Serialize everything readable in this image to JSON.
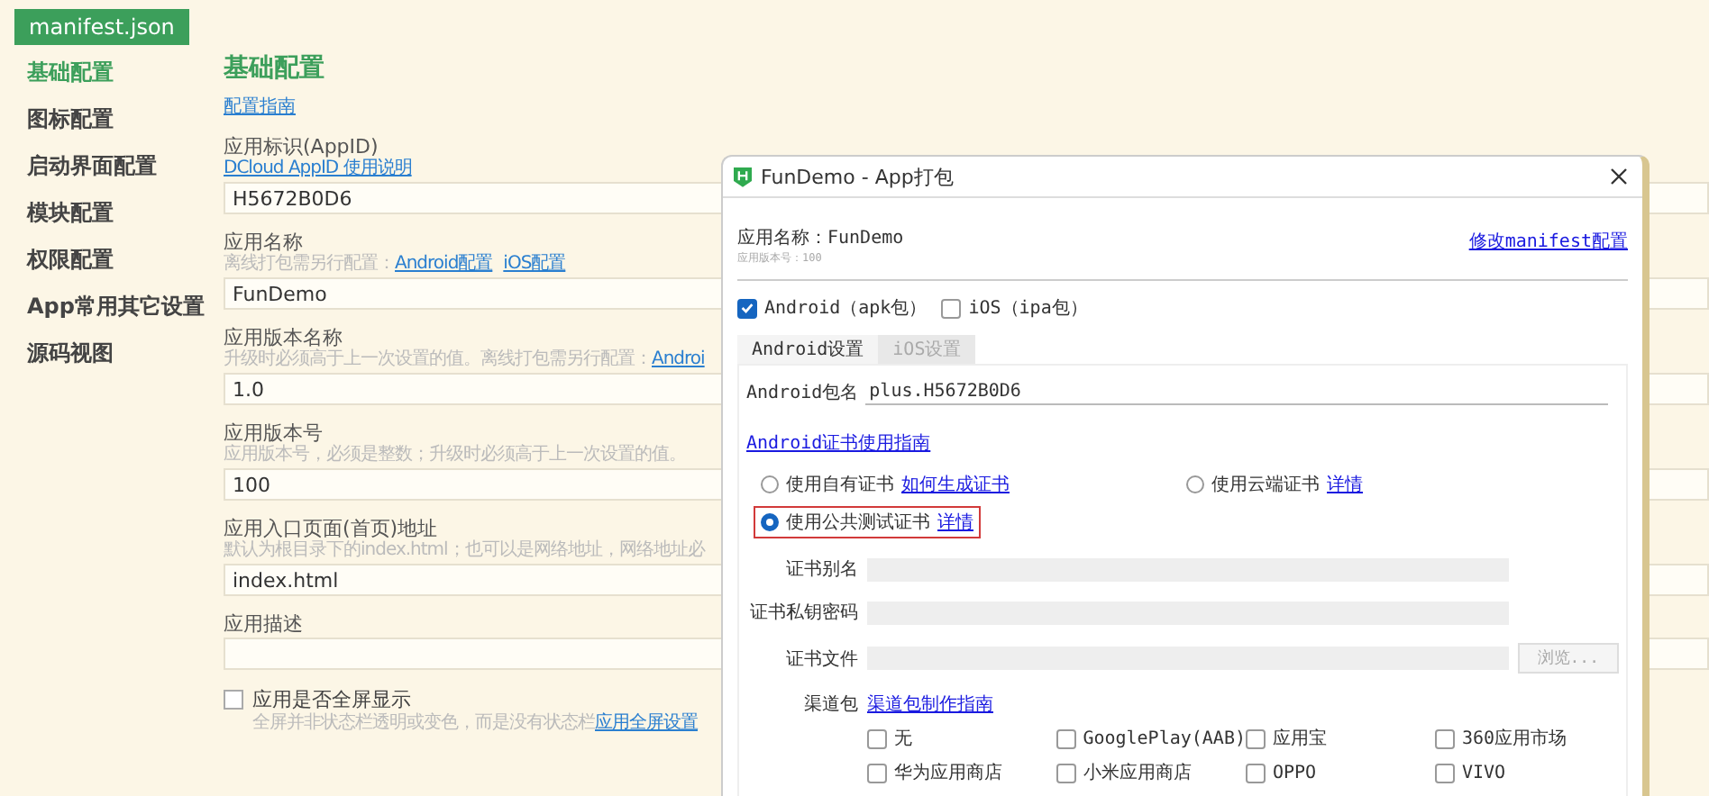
{
  "file_tab": {
    "label": "manifest.json"
  },
  "sidebar": {
    "items": [
      {
        "label": "基础配置",
        "selected": true
      },
      {
        "label": "图标配置",
        "selected": false
      },
      {
        "label": "启动界面配置",
        "selected": false
      },
      {
        "label": "模块配置",
        "selected": false
      },
      {
        "label": "权限配置",
        "selected": false
      },
      {
        "label": "App常用其它设置",
        "selected": false
      },
      {
        "label": "源码视图",
        "selected": false
      }
    ]
  },
  "main": {
    "title": "基础配置",
    "guide_link": "配置指南",
    "sections": [
      {
        "kind": "field",
        "label": "应用标识(AppID)",
        "hint": [
          {
            "kind": "link",
            "text": "DCloud AppID 使用说明"
          }
        ],
        "value": "H5672B0D6"
      },
      {
        "kind": "field",
        "label": "应用名称",
        "hint": [
          {
            "kind": "text",
            "text": "离线打包需另行配置："
          },
          {
            "kind": "link",
            "text": "Android配置"
          },
          {
            "kind": "link",
            "text": "iOS配置"
          }
        ],
        "value": "FunDemo"
      },
      {
        "kind": "field",
        "label": "应用版本名称",
        "hint": [
          {
            "kind": "text",
            "text": "升级时必须高于上一次设置的值。离线打包需另行配置："
          },
          {
            "kind": "link",
            "text": "Androi"
          }
        ],
        "value": "1.0"
      },
      {
        "kind": "field",
        "label": "应用版本号",
        "hint": [
          {
            "kind": "text",
            "text": "应用版本号，必须是整数；升级时必须高于上一次设置的值。"
          }
        ],
        "value": "100"
      },
      {
        "kind": "field",
        "label": "应用入口页面(首页)地址",
        "hint": [
          {
            "kind": "text",
            "text": "默认为根目录下的index.html；也可以是网络地址，网络地址必"
          }
        ],
        "value": "index.html"
      },
      {
        "kind": "field",
        "label": "应用描述"
      },
      {
        "kind": "checkbox",
        "label": "应用是否全屏显示",
        "checked": false,
        "hint": [
          {
            "kind": "text",
            "text": "全屏并非状态栏透明或变色，而是没有状态栏"
          },
          {
            "kind": "link",
            "text": "应用全屏设置"
          }
        ]
      }
    ]
  },
  "dialog": {
    "title": "FunDemo - App打包",
    "app_name": "应用名称：FunDemo",
    "app_version": "应用版本号：100",
    "manifest_link": "修改manifest配置",
    "platforms": [
      {
        "label": "Android（apk包）",
        "checked": true
      },
      {
        "label": "iOS（ipa包）",
        "checked": false
      }
    ],
    "tabs": [
      {
        "label": "Android设置",
        "selected": true
      },
      {
        "label": "iOS设置",
        "selected": false
      }
    ],
    "package": {
      "label": "Android包名",
      "value": "plus.H5672B0D6"
    },
    "cert_guide_link": "Android证书使用指南",
    "cert_options": [
      {
        "label": "使用自有证书",
        "link": "如何生成证书",
        "selected": false,
        "highlighted": false
      },
      {
        "label": "使用云端证书",
        "link": "详情",
        "selected": false,
        "highlighted": false
      },
      {
        "label": "使用公共测试证书",
        "link": "详情",
        "selected": true,
        "highlighted": true
      }
    ],
    "cert_fields": [
      {
        "label": "证书别名",
        "disabled": true
      },
      {
        "label": "证书私钥密码",
        "disabled": true
      },
      {
        "label": "证书文件",
        "disabled": true,
        "button": "浏览..."
      }
    ],
    "channel": {
      "label": "渠道包",
      "link": "渠道包制作指南",
      "options": [
        {
          "label": "无",
          "checked": false
        },
        {
          "label": "GooglePlay(AAB)",
          "checked": false
        },
        {
          "label": "应用宝",
          "checked": false
        },
        {
          "label": "360应用市场",
          "checked": false
        },
        {
          "label": "华为应用商店",
          "checked": false
        },
        {
          "label": "小米应用商店",
          "checked": false
        },
        {
          "label": "OPPO",
          "checked": false
        },
        {
          "label": "VIVO",
          "checked": false
        }
      ]
    }
  }
}
